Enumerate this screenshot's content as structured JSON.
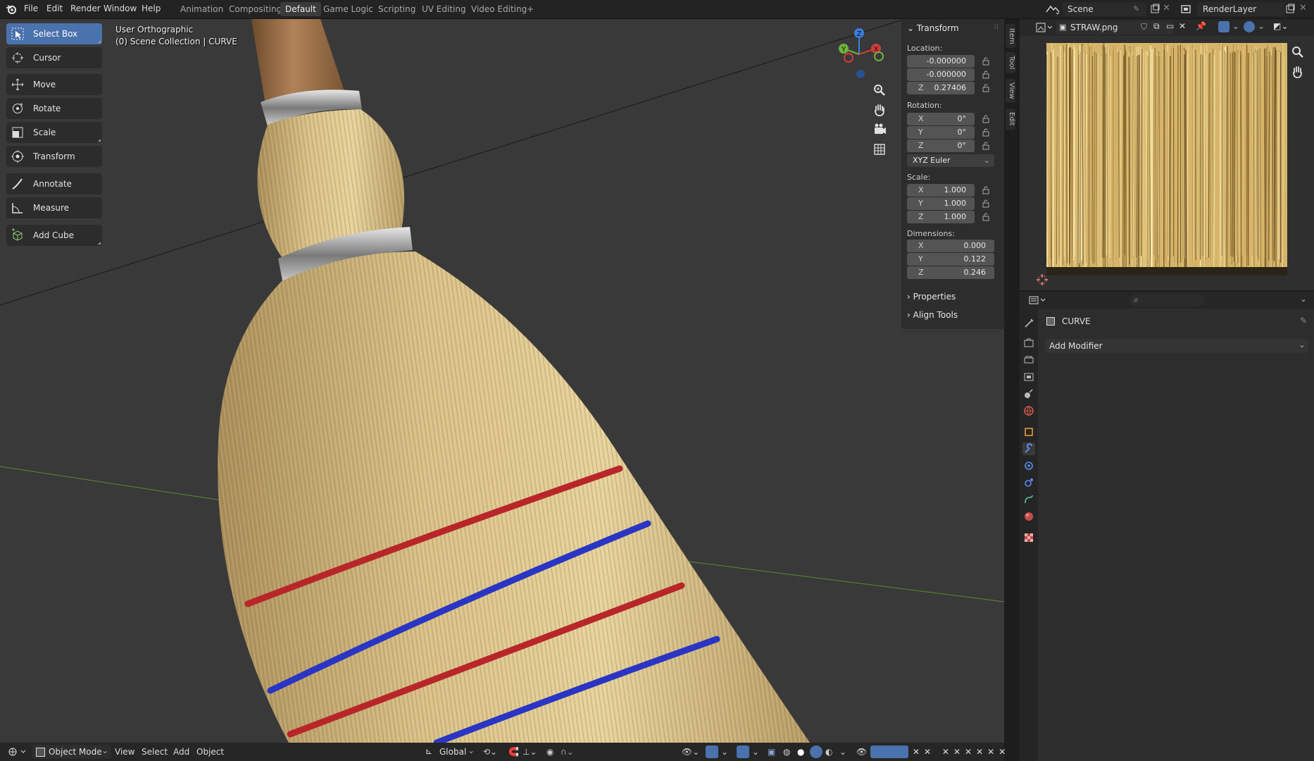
{
  "top_menu": [
    "File",
    "Edit",
    "Render",
    "Window",
    "Help"
  ],
  "workspace_tabs": [
    "Animation",
    "Compositing",
    "Default",
    "Game Logic",
    "Scripting",
    "UV Editing",
    "Video Editing"
  ],
  "workspace_add": "+",
  "scene_field": "Scene",
  "view_layer_field": "RenderLayer",
  "viewport": {
    "view_name": "User Orthographic",
    "collection_info": "(0) Scene Collection | CURVE",
    "tools": [
      "Select Box",
      "Cursor",
      "Move",
      "Rotate",
      "Scale",
      "Transform",
      "Annotate",
      "Measure",
      "Add Cube"
    ],
    "active_tool": "Select Box",
    "gizmo_axes": [
      "X",
      "Y",
      "Z"
    ]
  },
  "npanel": {
    "title": "Transform",
    "location_label": "Location:",
    "location": [
      "-0.000000",
      "-0.000000",
      "0.27406"
    ],
    "rotation_label": "Rotation:",
    "rotation": [
      "0°",
      "0°",
      "0°"
    ],
    "rotation_mode": "XYZ Euler",
    "scale_label": "Scale:",
    "scale": [
      "1.000",
      "1.000",
      "1.000"
    ],
    "dimensions_label": "Dimensions:",
    "dimensions": [
      "0.000",
      "0.122",
      "0.246"
    ],
    "axes": [
      "X",
      "Y",
      "Z"
    ],
    "properties_section": "Properties",
    "align_section": "Align Tools"
  },
  "side_tabs": [
    "Item",
    "Tool",
    "View",
    "Edit"
  ],
  "bottom_bar": {
    "mode": "Object Mode",
    "menus": [
      "View",
      "Select",
      "Add",
      "Object"
    ],
    "transform_orientation": "Global"
  },
  "image_editor": {
    "image_name": "STRAW.png"
  },
  "properties": {
    "object_name": "CURVE",
    "add_modifier": "Add Modifier"
  },
  "colors": {
    "accent": "#4a72ad",
    "viewport_bg": "#393939",
    "band_red": "#b8262a",
    "band_blue": "#2a35c4",
    "straw": "#d9bf82"
  }
}
